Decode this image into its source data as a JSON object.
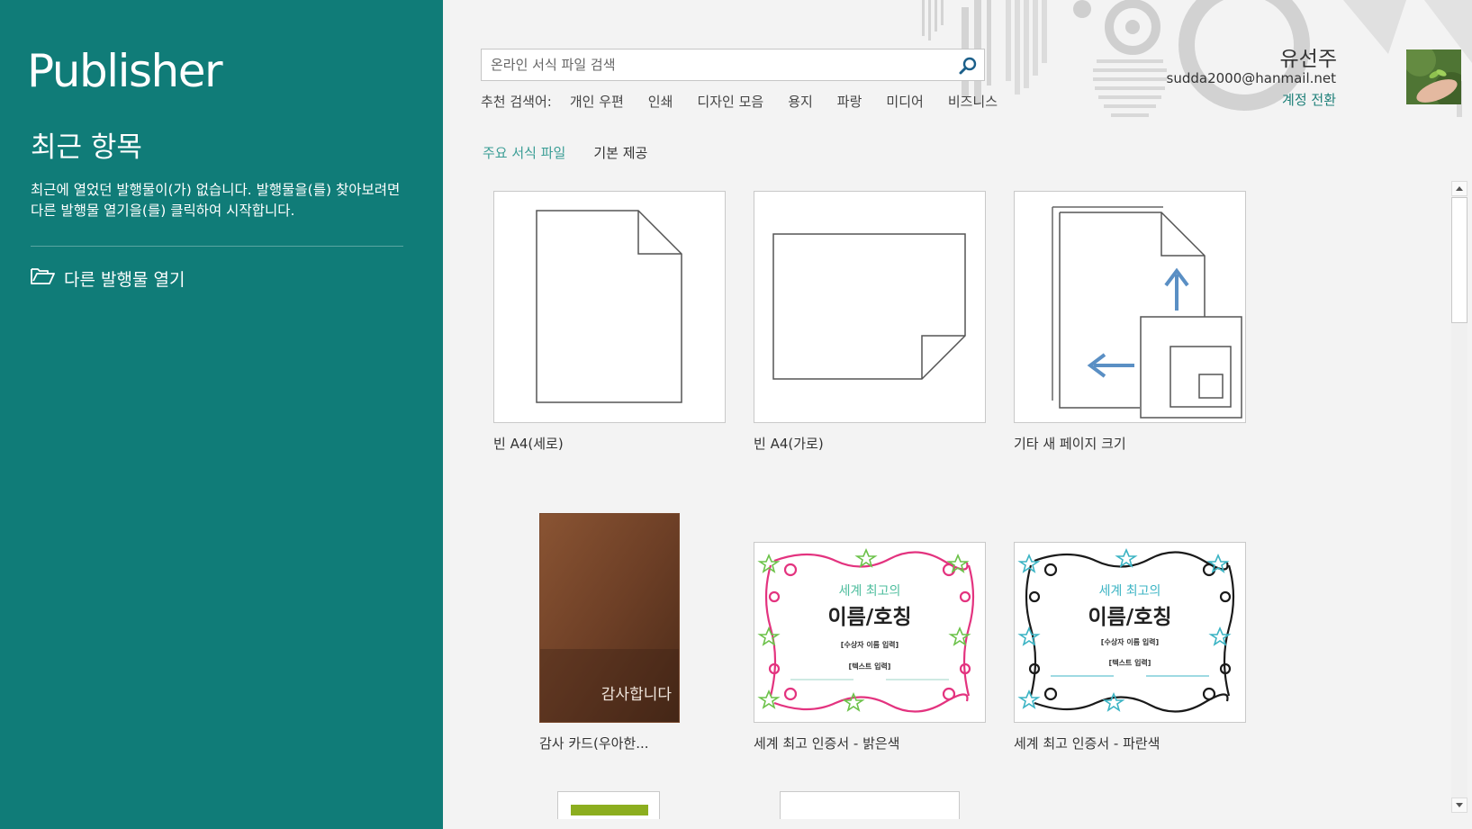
{
  "app": {
    "brand": "Publisher"
  },
  "left": {
    "recent_heading": "최근 항목",
    "recent_message": "최근에 열었던 발행물이(가) 없습니다. 발행물을(를) 찾아보려면 다른 발행물 열기을(를) 클릭하여 시작합니다.",
    "open_other_label": "다른 발행물 열기",
    "open_other_icon": "folder-open-icon"
  },
  "search": {
    "placeholder": "온라인 서식 파일 검색",
    "value": "",
    "button_icon": "search-icon"
  },
  "suggested": {
    "label": "추천 검색어:",
    "links": [
      "개인 우편",
      "인쇄",
      "디자인 모음",
      "용지",
      "파랑",
      "미디어",
      "비즈니스"
    ]
  },
  "tabs": [
    {
      "label": "주요 서식 파일",
      "active": true
    },
    {
      "label": "기본 제공",
      "active": false
    }
  ],
  "user": {
    "name": "유선주",
    "email": "sudda2000@hanmail.net",
    "switch_label": "계정 전환"
  },
  "templates": [
    {
      "label": "빈 A4(세로)"
    },
    {
      "label": "빈 A4(가로)"
    },
    {
      "label": "기타 새 페이지 크기"
    },
    {
      "label": "감사 카드(우아한...",
      "card_text": "감사합니다"
    },
    {
      "label": "세계 최고 인증서 - 밝은색",
      "title_small": "세계 최고의",
      "title_big": "이름/호칭",
      "line1": "[수상자 이름 입력]",
      "line2": "[텍스트 입력]",
      "accent": "#e3337f",
      "small_color": "#4dbd9d"
    },
    {
      "label": "세계 최고 인증서 - 파란색",
      "title_small": "세계 최고의",
      "title_big": "이름/호칭",
      "line1": "[수상자 이름 입력]",
      "line2": "[텍스트 입력]",
      "accent": "#1a1a1a",
      "small_color": "#3cb4c4"
    }
  ],
  "colors": {
    "left_bg": "#107c78",
    "accent_link": "#1d7f78",
    "active_tab": "#3a9d95"
  }
}
